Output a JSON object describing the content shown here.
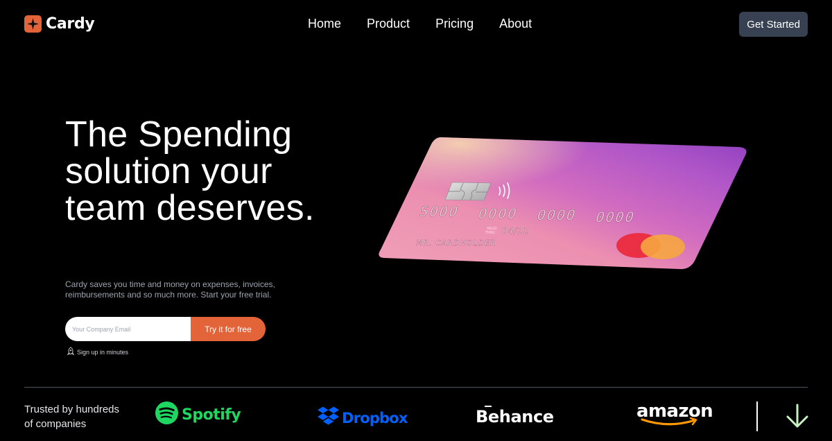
{
  "nav": {
    "logo_text": "Cardy",
    "links": [
      "Home",
      "Product",
      "Pricing",
      "About"
    ],
    "cta_label": "Get Started"
  },
  "hero": {
    "title": "The Spending solution your team deserves.",
    "subtitle": "Cardy saves you time and money on expenses, invoices, reimbursements and so much more. Start your free trial.",
    "email_placeholder": "Your Company Email",
    "email_value": "",
    "submit_label": "Try it for free",
    "note": "Sign up in minutes"
  },
  "card": {
    "number_groups": [
      "5000",
      "0000",
      "0000",
      "0000"
    ],
    "valid_label_1": "VALID",
    "valid_label_2": "THRU",
    "expiry": "04/22",
    "holder": "MR. CARDHOLDER"
  },
  "trusted": {
    "text": "Trusted by hundreds of companies",
    "brands": [
      "Spotify",
      "Dropbox",
      "Behance",
      "amazon"
    ]
  },
  "colors": {
    "accent": "#e4643a",
    "cta_bg": "#374151",
    "spotify": "#1ed760",
    "dropbox": "#0061fe",
    "amazon_smile": "#ff9900"
  }
}
